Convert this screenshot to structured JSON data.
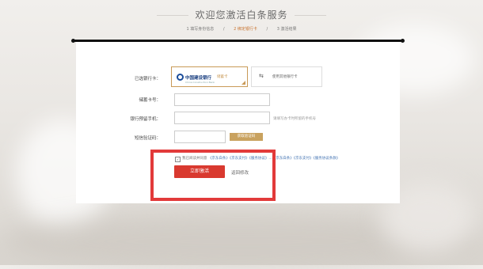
{
  "page": {
    "title": "欢迎您激活白条服务"
  },
  "steps": [
    {
      "label": "1  填写身份信息",
      "active": false
    },
    {
      "label": "/",
      "active": false
    },
    {
      "label": "2  绑定银行卡",
      "active": true
    },
    {
      "label": "/",
      "active": false
    },
    {
      "label": "3  激活结果",
      "active": false
    }
  ],
  "form": {
    "selected_card_label": "已选银行卡：",
    "selected_bank": {
      "name": "中国建设银行",
      "sub": "China Construction Bank",
      "type": "储蓄卡"
    },
    "other_card_text": "使用其他银行卡",
    "card_number_label": "储蓄卡号：",
    "phone_label": "银行预留手机：",
    "phone_hint": "请填写办卡时所留的手机号",
    "sms_label": "短信验证码：",
    "sms_button": "获取验证码",
    "agreement_prefix": "我已阅读并同意",
    "agreement_links": "《京东白条》《京东支付》《服务协议》...《京东白条》《京东支付》《服务协议条款》",
    "activate_button": "立即激活",
    "back_link": "返回修改"
  },
  "colors": {
    "accent": "#c99a57",
    "primary": "#d9392f",
    "highlight": "#e23a3a",
    "link": "#3d6fb0"
  }
}
